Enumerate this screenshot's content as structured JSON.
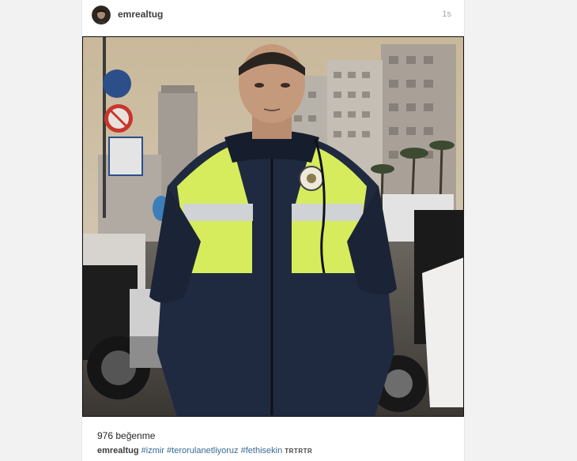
{
  "post": {
    "username": "emrealtug",
    "time": "1s",
    "likes": "976 beğenme",
    "caption": {
      "username": "emrealtug",
      "hashtags": [
        "#izmir",
        "#terorulanetliyoruz",
        "#fethisekin"
      ],
      "extra": "TRTRTR"
    }
  },
  "icons": {
    "avatar": "profile-avatar",
    "photo": "police-officer-photo"
  },
  "colors": {
    "background": "#f2f2f2",
    "card": "#ffffff",
    "hashtag": "#3b6a8f",
    "timestamp": "#a5a7aa",
    "vest": "#d7ec5c"
  }
}
